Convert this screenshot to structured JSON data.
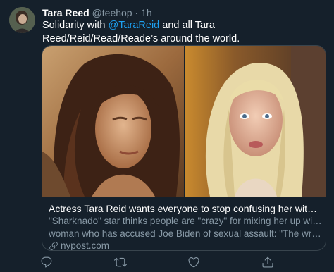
{
  "author": {
    "name": "Tara Reed",
    "handle": "@teehop",
    "separator": "·",
    "time": "1h"
  },
  "tweet": {
    "text_before": "Solidarity with ",
    "mention": "@TaraReid",
    "text_after": " and all Tara Reed/Reid/Read/Reade’s around the world."
  },
  "card": {
    "title": "Actress Tara Reid wants everyone to stop confusing her with Tara Re...",
    "description_line1": "\"Sharknado\" star thinks people are \"crazy\" for mixing her up with the",
    "description_line2": "woman who has accused Joe Biden of sexual assault: \"The wrong ...",
    "domain": "nypost.com"
  },
  "actions": [
    "reply-icon",
    "retweet-icon",
    "like-icon",
    "share-icon"
  ],
  "colors": {
    "background": "#15202b",
    "accent": "#1da1f2",
    "secondary_text": "#8899a6",
    "border": "#38444d"
  }
}
